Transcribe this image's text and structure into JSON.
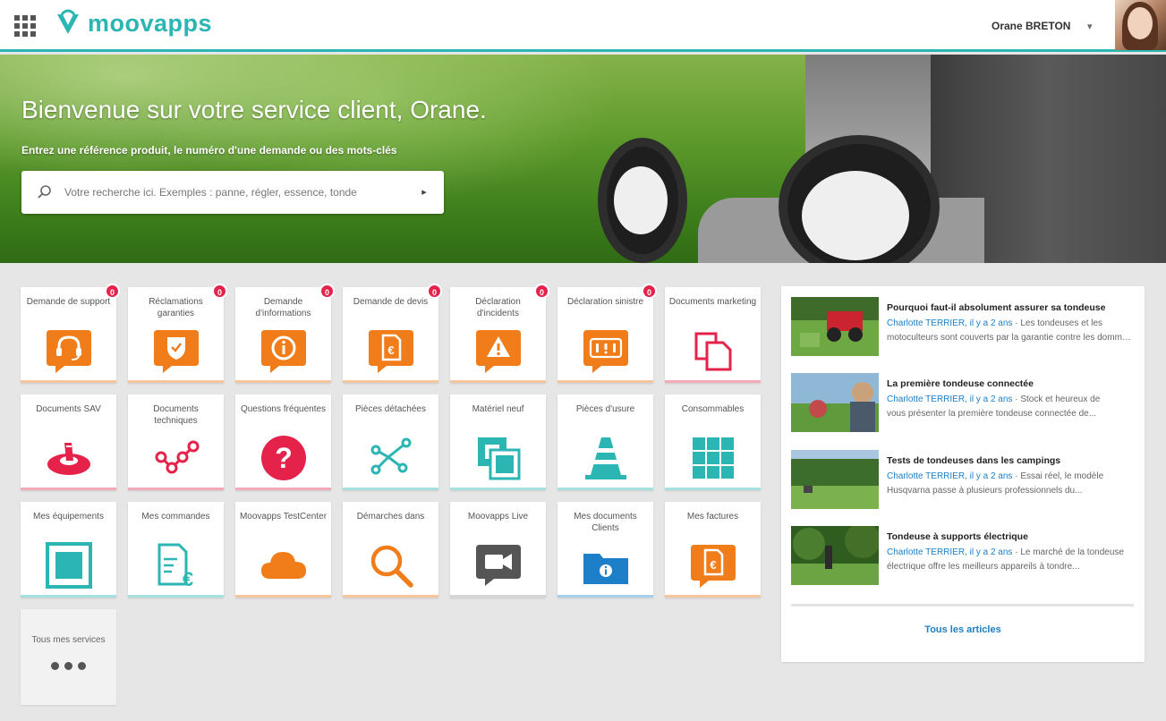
{
  "header": {
    "app_name": "moovapps",
    "user_name": "Orane BRETON",
    "caret": "▾"
  },
  "hero": {
    "title": "Bienvenue sur votre service client, Orane.",
    "subtitle": "Entrez une référence produit, le numéro d'une demande ou des mots-clés",
    "search_placeholder": "Votre recherche ici. Exemples : panne, régler, essence, tonde",
    "search_go": "▸"
  },
  "tiles": [
    {
      "label": "Demande de support",
      "icon": "headset-icon",
      "color": "#f07d1a",
      "badge": "0"
    },
    {
      "label": "Réclamations garanties",
      "icon": "shield-icon",
      "color": "#f07d1a",
      "badge": "0"
    },
    {
      "label": "Demande d'informations",
      "icon": "info-icon",
      "color": "#f07d1a",
      "badge": "0"
    },
    {
      "label": "Demande de devis",
      "icon": "quote-icon",
      "color": "#f07d1a",
      "badge": "0"
    },
    {
      "label": "Déclaration d'incidents",
      "icon": "warning-icon",
      "color": "#f07d1a",
      "badge": "0"
    },
    {
      "label": "Déclaration sinistre",
      "icon": "incident-icon",
      "color": "#f07d1a",
      "badge": "0"
    },
    {
      "label": "Documents marketing",
      "icon": "documents-icon",
      "color": "#e5234a",
      "badge": ""
    },
    {
      "label": "Documents SAV",
      "icon": "sav-icon",
      "color": "#e5234a",
      "badge": ""
    },
    {
      "label": "Documents techniques",
      "icon": "molecule-icon",
      "color": "#e5234a",
      "badge": ""
    },
    {
      "label": "Questions fréquentes",
      "icon": "question-icon",
      "color": "#e5234a",
      "badge": ""
    },
    {
      "label": "Pièces détachées",
      "icon": "network-icon",
      "color": "#2bb6b3",
      "badge": ""
    },
    {
      "label": "Matériel neuf",
      "icon": "squares-icon",
      "color": "#2bb6b3",
      "badge": ""
    },
    {
      "label": "Pièces d'usure",
      "icon": "cone-icon",
      "color": "#2bb6b3",
      "badge": ""
    },
    {
      "label": "Consommables",
      "icon": "grid-icon",
      "color": "#2bb6b3",
      "badge": ""
    },
    {
      "label": "Mes équipements",
      "icon": "equipment-icon",
      "color": "#2bb6b3",
      "badge": ""
    },
    {
      "label": "Mes commandes",
      "icon": "invoice-euro-icon",
      "color": "#2bb6b3",
      "badge": ""
    },
    {
      "label": "Moovapps TestCenter",
      "icon": "cloud-icon",
      "color": "#f07d1a",
      "badge": ""
    },
    {
      "label": "Démarches dans",
      "icon": "magnifier-icon",
      "color": "#f07d1a",
      "badge": ""
    },
    {
      "label": "Moovapps Live",
      "icon": "video-icon",
      "color": "#555555",
      "badge": ""
    },
    {
      "label": "Mes documents Clients",
      "icon": "folder-info-icon",
      "color": "#1c7fc7",
      "badge": ""
    },
    {
      "label": "Mes factures",
      "icon": "invoice-icon",
      "color": "#f07d1a",
      "badge": ""
    }
  ],
  "all_services": {
    "label": "Tous mes services"
  },
  "news": {
    "items": [
      {
        "title": "Pourquoi faut-il absolument assurer sa tondeuse",
        "author": "Charlotte TERRIER, il y a 2 ans",
        "meta_rest": " · Les tondeuses et les",
        "excerpt": "motoculteurs sont couverts par la garantie contre les dommages..."
      },
      {
        "title": "La première tondeuse connectée",
        "author": "Charlotte TERRIER, il y a 2 ans",
        "meta_rest": " · Stock et heureux de",
        "excerpt": "vous présenter la première tondeuse connectée de..."
      },
      {
        "title": "Tests de tondeuses dans les campings",
        "author": "Charlotte TERRIER, il y a 2 ans",
        "meta_rest": " · Essai réel, le modèle",
        "excerpt": "Husqvarna passe à plusieurs professionnels du..."
      },
      {
        "title": "Tondeuse à supports électrique",
        "author": "Charlotte TERRIER, il y a 2 ans",
        "meta_rest": " · Le marché de la tondeuse",
        "excerpt": "électrique offre les meilleurs appareils à tondre..."
      }
    ],
    "more_label": "Tous les articles"
  }
}
